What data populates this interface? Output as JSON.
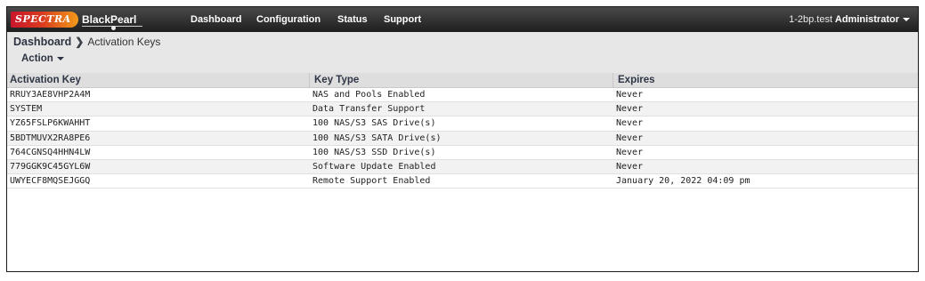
{
  "brand": {
    "left_logo": "SPECTRA",
    "product": "BlackPearl"
  },
  "nav": {
    "items": [
      {
        "label": "Dashboard"
      },
      {
        "label": "Configuration"
      },
      {
        "label": "Status"
      },
      {
        "label": "Support"
      }
    ],
    "host": "1-2bp.test",
    "user": "Administrator"
  },
  "breadcrumb": {
    "home": "Dashboard",
    "current": "Activation Keys"
  },
  "toolbar": {
    "action_label": "Action"
  },
  "table": {
    "columns": [
      "Activation Key",
      "Key Type",
      "Expires"
    ],
    "rows": [
      [
        "RRUY3AE8VHP2A4M",
        "NAS and Pools Enabled",
        "Never"
      ],
      [
        "SYSTEM",
        "Data Transfer Support",
        "Never"
      ],
      [
        "YZ65FSLP6KWAHHT",
        "100 NAS/S3 SAS Drive(s)",
        "Never"
      ],
      [
        "5BDTMUVX2RA8PE6",
        "100 NAS/S3 SATA Drive(s)",
        "Never"
      ],
      [
        "764CGNSQ4HHN4LW",
        "100 NAS/S3 SSD Drive(s)",
        "Never"
      ],
      [
        "779GGK9C45GYL6W",
        "Software Update Enabled",
        "Never"
      ],
      [
        "UWYECF8MQSEJGGQ",
        "Remote Support Enabled",
        "January 20, 2022 04:09 pm"
      ]
    ]
  },
  "colors": {
    "topbar": "#2a2a2a",
    "subbar": "#e7e7e7",
    "header": "#dedede",
    "brand_red": "#c9152b",
    "brand_orange": "#f19b19"
  }
}
